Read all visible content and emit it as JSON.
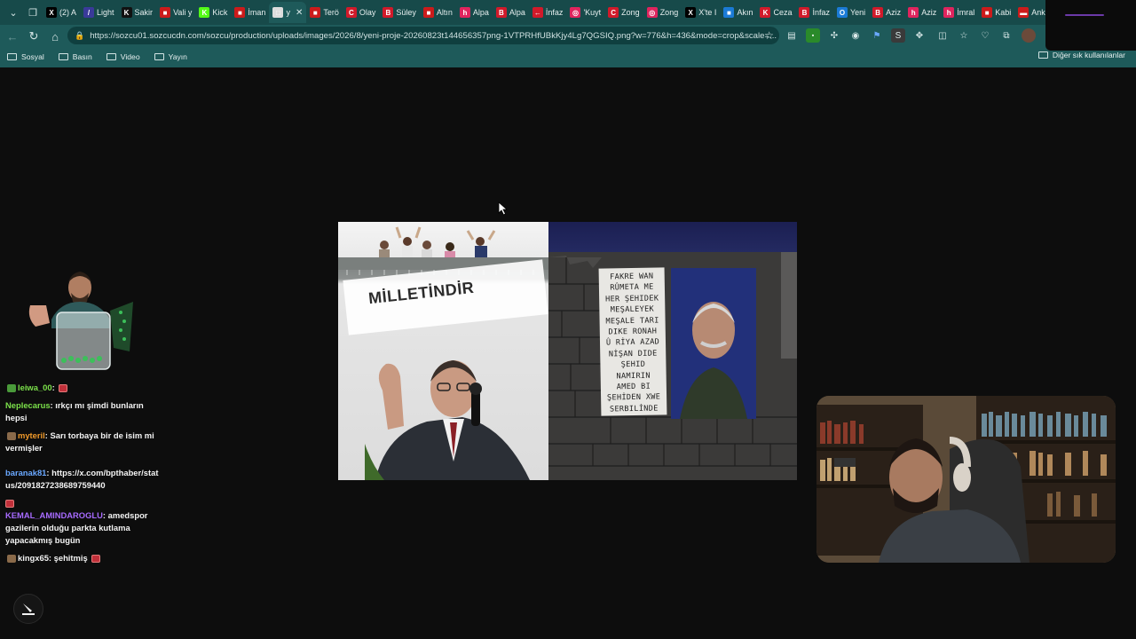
{
  "browser": {
    "tabs": [
      {
        "label": "(2) A",
        "icon": "x-logo",
        "color": "#000000",
        "glyph": "X"
      },
      {
        "label": "Light",
        "icon": "feather-icon",
        "color": "#3a3a9a",
        "glyph": "/"
      },
      {
        "label": "Sakir",
        "icon": "kick-icon",
        "color": "#111111",
        "glyph": "K"
      },
      {
        "label": "Vali y",
        "icon": "newspaper-icon",
        "color": "#cc1b1b",
        "glyph": "■"
      },
      {
        "label": "Kick",
        "icon": "kick-icon",
        "color": "#53fc18",
        "glyph": "K"
      },
      {
        "label": "İman",
        "icon": "newspaper-icon",
        "color": "#cc1b1b",
        "glyph": "■"
      },
      {
        "label": "y",
        "icon": "page-icon",
        "color": "#dddddd",
        "glyph": "□"
      },
      {
        "label": "Terö",
        "icon": "newspaper-icon",
        "color": "#cc1b1b",
        "glyph": "■"
      },
      {
        "label": "Olay",
        "icon": "c-icon",
        "color": "#d11a2a",
        "glyph": "C"
      },
      {
        "label": "Süley",
        "icon": "b-icon",
        "color": "#d11a2a",
        "glyph": "B"
      },
      {
        "label": "Altın",
        "icon": "newspaper-icon",
        "color": "#cc1b1b",
        "glyph": "■"
      },
      {
        "label": "Alpa",
        "icon": "h-icon",
        "color": "#e0245e",
        "glyph": "h"
      },
      {
        "label": "Alpa",
        "icon": "b-icon",
        "color": "#d11a2a",
        "glyph": "B"
      },
      {
        "label": "İnfaz",
        "icon": "arrow-icon",
        "color": "#d11a2a",
        "glyph": "←"
      },
      {
        "label": "'Kuyt",
        "icon": "circle-icon",
        "color": "#e0245e",
        "glyph": "◎"
      },
      {
        "label": "Zong",
        "icon": "c-icon",
        "color": "#d11a2a",
        "glyph": "C"
      },
      {
        "label": "Zong",
        "icon": "circle-icon",
        "color": "#e0245e",
        "glyph": "◎"
      },
      {
        "label": "X'te I",
        "icon": "x-logo",
        "color": "#000000",
        "glyph": "X"
      },
      {
        "label": "Akın",
        "icon": "msn-icon",
        "color": "#1b7bd6",
        "glyph": "■"
      },
      {
        "label": "Ceza",
        "icon": "k-icon",
        "color": "#d11a2a",
        "glyph": "K"
      },
      {
        "label": "İnfaz",
        "icon": "b-icon",
        "color": "#d11a2a",
        "glyph": "B"
      },
      {
        "label": "Yeni",
        "icon": "o-icon",
        "color": "#1b7bd6",
        "glyph": "O"
      },
      {
        "label": "Aziz",
        "icon": "b-icon",
        "color": "#d11a2a",
        "glyph": "B"
      },
      {
        "label": "Aziz",
        "icon": "h-icon",
        "color": "#e0245e",
        "glyph": "h"
      },
      {
        "label": "İmral",
        "icon": "h-icon",
        "color": "#e0245e",
        "glyph": "h"
      },
      {
        "label": "Kabi",
        "icon": "newspaper-icon",
        "color": "#cc1b1b",
        "glyph": "■"
      },
      {
        "label": "Anka",
        "icon": "flag-icon",
        "color": "#cc1b1b",
        "glyph": "▬"
      }
    ],
    "url": "https://sozcu01.sozcucdn.com/sozcu/production/uploads/images/2026/8/yeni-proje-20260823t144656357png-1VTPRHfUBkKjy4Lg7QGSIQ.png?w=776&h=436&mode=crop&scale=...",
    "bookmarks": [
      "Sosyal",
      "Basın",
      "Video",
      "Yayın"
    ],
    "bookmarks_other": "Diğer sık kullanılanlar"
  },
  "image": {
    "left_banner_text": "MİLLETİNDİR",
    "right_banner_lines": [
      "FAKRE WAN",
      "RÛMETA ME",
      "HER ŞEHIDEK",
      "MEŞALEYEK",
      "MEŞALE TARI",
      "DIKE RONAH",
      "Û RİYA AZAD",
      "NİŞAN DIDE",
      "ŞEHID",
      "NAMIRIN",
      "AMED BI",
      "ŞEHİDEN XWE",
      "SERBILİNDE"
    ]
  },
  "chat": [
    {
      "user": "leiwa_00",
      "text": "",
      "color": "user-green",
      "emote_before": "green",
      "emote_after": "red"
    },
    {
      "user": "Neplecarus",
      "text": "ırkçı mı şimdi bunların hepsi",
      "color": "user-green"
    },
    {
      "user": "myteril",
      "text": "Sarı torbaya bir de isim mi vermişler",
      "color": "user-orange",
      "emote_before": "brown"
    },
    {
      "user": "baranak81",
      "text": "https://x.com/bpthaber/status/2091827238689759440",
      "color": "user-blue"
    },
    {
      "user": "KEMAL_AMINDAROGLU",
      "text": "amedspor gazilerin olduğu parkta kutlama yapacakmış bugün",
      "color": "user-purple",
      "emote_top": "red"
    },
    {
      "user": "kingx65",
      "text": "şehitmiş",
      "color": "user-white",
      "emote_before": "brown",
      "emote_after": "red"
    }
  ]
}
